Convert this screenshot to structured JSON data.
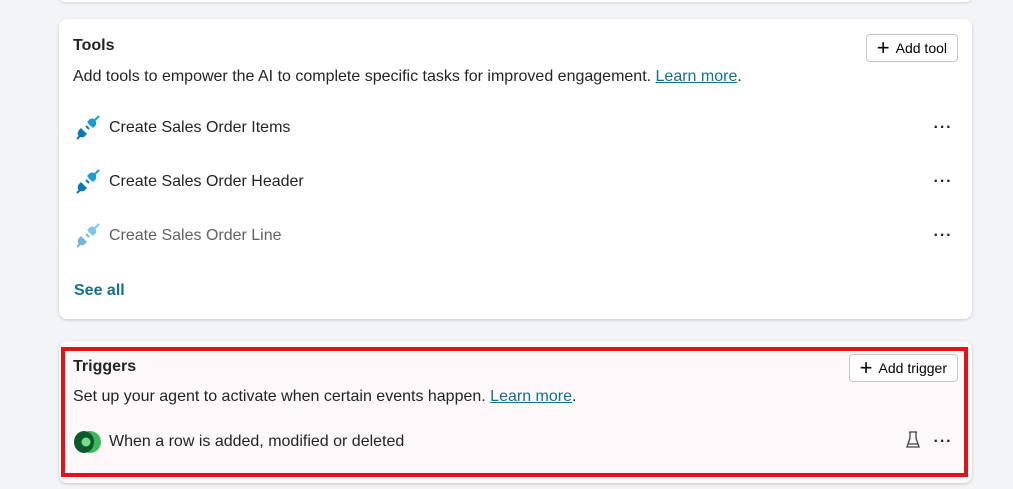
{
  "tools": {
    "title": "Tools",
    "add_label": "Add tool",
    "description": "Add tools to empower the AI to complete specific tasks for improved engagement.",
    "learn_more": "Learn more",
    "items": [
      {
        "label": "Create Sales Order Items",
        "icon": "plug-icon"
      },
      {
        "label": "Create Sales Order Header",
        "icon": "plug-icon"
      },
      {
        "label": "Create Sales Order Line",
        "icon": "plug-icon",
        "disabled": true
      }
    ],
    "more": "···",
    "see_all": "See all"
  },
  "triggers": {
    "title": "Triggers",
    "add_label": "Add trigger",
    "description": "Set up your agent to activate when certain events happen.",
    "learn_more": "Learn more",
    "items": [
      {
        "label": "When a row is added, modified or deleted",
        "icon": "dataverse-icon"
      }
    ],
    "more": "···"
  },
  "colors": {
    "highlight": "#e0131b",
    "link": "#11718f"
  }
}
